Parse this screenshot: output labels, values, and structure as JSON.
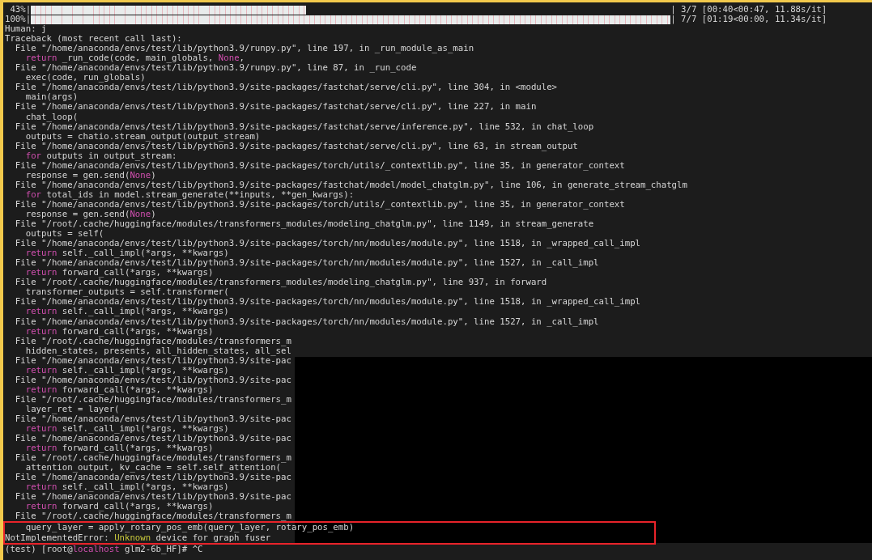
{
  "terminal": {
    "progress": [
      {
        "percent": " 43%|",
        "level": 0.43,
        "stats": "| 3/7 [00:40<00:47, 11.88s/it]"
      },
      {
        "percent": "100%|",
        "level": 1,
        "stats": "| 7/7 [01:19<00:00, 11.34s/it]"
      }
    ],
    "blocks": [
      {
        "framed": false,
        "redacted": true,
        "lines": [
          {
            "text": "Human: j"
          },
          {
            "text": "Traceback (most recent call last):"
          },
          {
            "text": "  File \"/home/anaconda/envs/test/lib/python3.9/runpy.py\", line 197, in _run_module_as_main"
          },
          {
            "parts": [
              {
                "kind": "keyword",
                "text": "    return"
              },
              {
                "kind": "plain",
                "text": " _run_code(code, main_globals, "
              },
              {
                "kind": "keyword",
                "text": "None"
              },
              {
                "kind": "plain",
                "text": ","
              }
            ]
          },
          {
            "text": "  File \"/home/anaconda/envs/test/lib/python3.9/runpy.py\", line 87, in _run_code"
          },
          {
            "text": "    exec(code, run_globals)"
          },
          {
            "text": "  File \"/home/anaconda/envs/test/lib/python3.9/site-packages/fastchat/serve/cli.py\", line 304, in <module>"
          },
          {
            "text": "    main(args)"
          },
          {
            "text": "  File \"/home/anaconda/envs/test/lib/python3.9/site-packages/fastchat/serve/cli.py\", line 227, in main"
          },
          {
            "text": "    chat_loop("
          },
          {
            "text": "  File \"/home/anaconda/envs/test/lib/python3.9/site-packages/fastchat/serve/inference.py\", line 532, in chat_loop"
          },
          {
            "text": "    outputs = chatio.stream_output(output_stream)"
          },
          {
            "text": "  File \"/home/anaconda/envs/test/lib/python3.9/site-packages/fastchat/serve/cli.py\", line 63, in stream_output"
          },
          {
            "parts": [
              {
                "kind": "keyword",
                "text": "    for"
              },
              {
                "kind": "plain",
                "text": " outputs in output_stream:"
              }
            ]
          },
          {
            "text": "  File \"/home/anaconda/envs/test/lib/python3.9/site-packages/torch/utils/_contextlib.py\", line 35, in generator_context"
          },
          {
            "parts": [
              {
                "kind": "plain",
                "text": "    response = gen.send("
              },
              {
                "kind": "keyword",
                "text": "None"
              },
              {
                "kind": "plain",
                "text": ")"
              }
            ]
          },
          {
            "text": "  File \"/home/anaconda/envs/test/lib/python3.9/site-packages/fastchat/model/model_chatglm.py\", line 106, in generate_stream_chatglm"
          },
          {
            "parts": [
              {
                "kind": "keyword",
                "text": "    for"
              },
              {
                "kind": "plain",
                "text": " total_ids in model.stream_generate(**inputs, **gen_kwargs):"
              }
            ]
          },
          {
            "text": "  File \"/home/anaconda/envs/test/lib/python3.9/site-packages/torch/utils/_contextlib.py\", line 35, in generator_context"
          },
          {
            "parts": [
              {
                "kind": "plain",
                "text": "    response = gen.send("
              },
              {
                "kind": "keyword",
                "text": "None"
              },
              {
                "kind": "plain",
                "text": ")"
              }
            ]
          },
          {
            "text": "  File \"/root/.cache/huggingface/modules/transformers_modules/modeling_chatglm.py\", line 1149, in stream_generate"
          },
          {
            "text": "    outputs = self("
          },
          {
            "text": "  File \"/home/anaconda/envs/test/lib/python3.9/site-packages/torch/nn/modules/module.py\", line 1518, in _wrapped_call_impl"
          },
          {
            "parts": [
              {
                "kind": "keyword",
                "text": "    return"
              },
              {
                "kind": "plain",
                "text": " self._call_impl(*args, **kwargs)"
              }
            ]
          },
          {
            "text": "  File \"/home/anaconda/envs/test/lib/python3.9/site-packages/torch/nn/modules/module.py\", line 1527, in _call_impl"
          },
          {
            "parts": [
              {
                "kind": "keyword",
                "text": "    return"
              },
              {
                "kind": "plain",
                "text": " forward_call(*args, **kwargs)"
              }
            ]
          },
          {
            "text": "  File \"/root/.cache/huggingface/modules/transformers_modules/modeling_chatglm.py\", line 937, in forward"
          },
          {
            "text": "    transformer_outputs = self.transformer("
          },
          {
            "text": "  File \"/home/anaconda/envs/test/lib/python3.9/site-packages/torch/nn/modules/module.py\", line 1518, in _wrapped_call_impl"
          },
          {
            "parts": [
              {
                "kind": "keyword",
                "text": "    return"
              },
              {
                "kind": "plain",
                "text": " self._call_impl(*args, **kwargs)"
              }
            ]
          },
          {
            "text": "  File \"/home/anaconda/envs/test/lib/python3.9/site-packages/torch/nn/modules/module.py\", line 1527, in _call_impl"
          },
          {
            "parts": [
              {
                "kind": "keyword",
                "text": "    return"
              },
              {
                "kind": "plain",
                "text": " forward_call(*args, **kwargs)"
              }
            ]
          },
          {
            "text": "  File \"/root/.cache/huggingface/modules/transformers_m"
          },
          {
            "text": "    hidden_states, presents, all_hidden_states, all_sel"
          },
          {
            "text": "  File \"/home/anaconda/envs/test/lib/python3.9/site-pac"
          },
          {
            "parts": [
              {
                "kind": "keyword",
                "text": "    return"
              },
              {
                "kind": "plain",
                "text": " self._call_impl(*args, **kwargs)"
              }
            ]
          },
          {
            "text": "  File \"/home/anaconda/envs/test/lib/python3.9/site-pac"
          },
          {
            "parts": [
              {
                "kind": "keyword",
                "text": "    return"
              },
              {
                "kind": "plain",
                "text": " forward_call(*args, **kwargs)"
              }
            ]
          },
          {
            "text": "  File \"/root/.cache/huggingface/modules/transformers_m"
          },
          {
            "text": "    layer_ret = layer("
          },
          {
            "text": "  File \"/home/anaconda/envs/test/lib/python3.9/site-pac"
          },
          {
            "parts": [
              {
                "kind": "keyword",
                "text": "    return"
              },
              {
                "kind": "plain",
                "text": " self._call_impl(*args, **kwargs)"
              }
            ]
          },
          {
            "text": "  File \"/home/anaconda/envs/test/lib/python3.9/site-pac"
          },
          {
            "parts": [
              {
                "kind": "keyword",
                "text": "    return"
              },
              {
                "kind": "plain",
                "text": " forward_call(*args, **kwargs)"
              }
            ]
          },
          {
            "text": "  File \"/root/.cache/huggingface/modules/transformers_m"
          },
          {
            "text": "    attention_output, kv_cache = self.self_attention("
          },
          {
            "text": "  File \"/home/anaconda/envs/test/lib/python3.9/site-pac"
          },
          {
            "parts": [
              {
                "kind": "keyword",
                "text": "    return"
              },
              {
                "kind": "plain",
                "text": " self._call_impl(*args, **kwargs)"
              }
            ]
          },
          {
            "text": "  File \"/home/anaconda/envs/test/lib/python3.9/site-pac"
          },
          {
            "parts": [
              {
                "kind": "keyword",
                "text": "    return"
              },
              {
                "kind": "plain",
                "text": " forward_call(*args, **kwargs)"
              }
            ]
          },
          {
            "text": "  File \"/root/.cache/huggingface/modules/transformers_m"
          }
        ]
      },
      {
        "framed": true,
        "lines": [
          {
            "text": "    query_layer = apply_rotary_pos_emb(query_layer, rotary_pos_emb)"
          },
          {
            "parts": [
              {
                "kind": "plain",
                "text": "NotImplementedError: "
              },
              {
                "kind": "warning",
                "text": "Unknown"
              },
              {
                "kind": "plain",
                "text": " device for graph fuser"
              }
            ]
          }
        ]
      },
      {
        "framed": false,
        "lines": [
          {
            "parts": [
              {
                "kind": "plain",
                "text": "(test) [root@"
              },
              {
                "kind": "keyword",
                "text": "localhost"
              },
              {
                "kind": "plain",
                "text": " glm2-6b_HF]# ^C"
              }
            ]
          }
        ]
      }
    ]
  }
}
